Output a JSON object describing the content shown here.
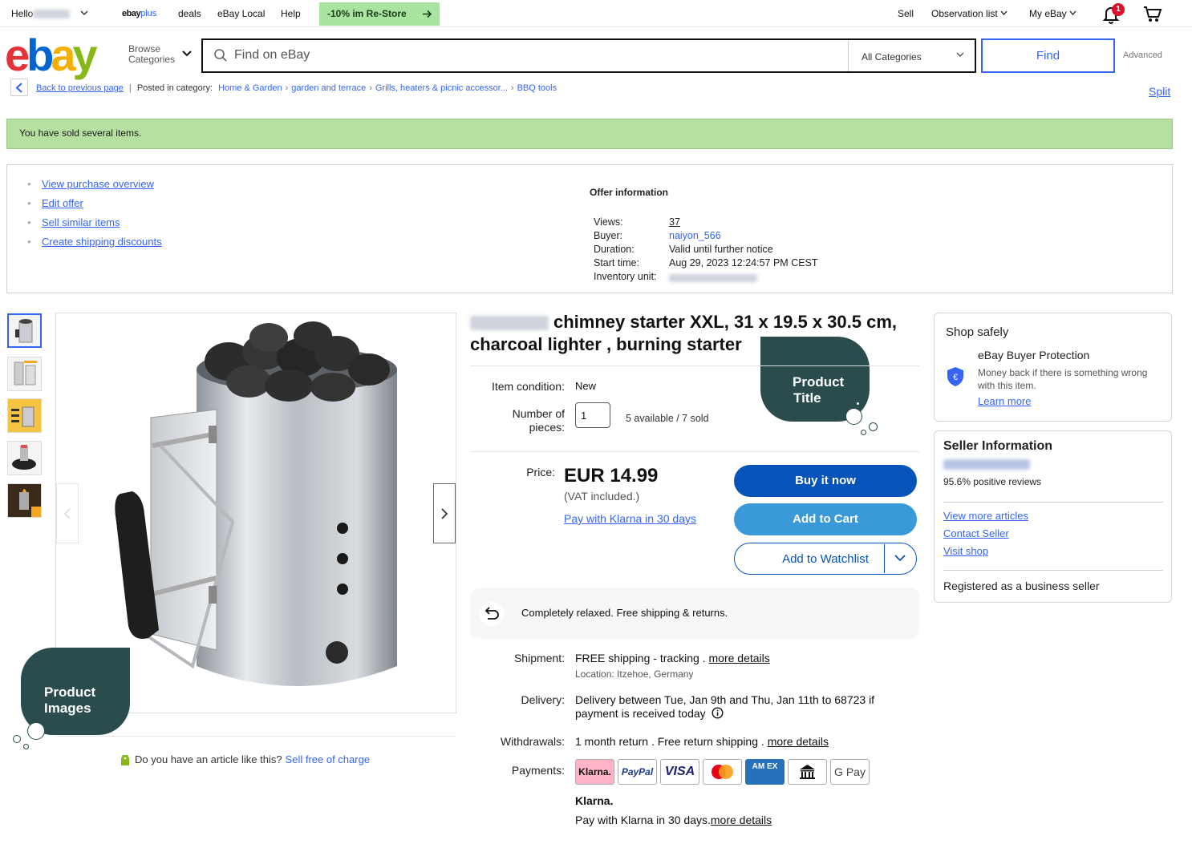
{
  "topbar": {
    "hello": "Hello",
    "ebay_plus_a": "ebay",
    "ebay_plus_b": "plus",
    "deals": "deals",
    "ebay_local": "eBay Local",
    "help": "Help",
    "restore": "-10% im Re-Store",
    "sell": "Sell",
    "observation": "Observation list",
    "my_ebay": "My eBay",
    "notification_count": "1"
  },
  "header": {
    "logo": [
      "e",
      "b",
      "a",
      "y"
    ],
    "browse_line1": "Browse",
    "browse_line2": "Categories",
    "search_placeholder": "Find on eBay",
    "category": "All Categories",
    "find": "Find",
    "advanced": "Advanced"
  },
  "breadcrumb": {
    "back": "Back to previous page",
    "posted_in": "Posted in category:",
    "items": [
      "Home & Garden",
      "garden and terrace",
      "Grills, heaters & picnic accessor...",
      "BBQ tools"
    ],
    "split": "Split"
  },
  "banner": {
    "sold_text": "You have sold several items."
  },
  "seller_actions": {
    "links": [
      "View purchase overview",
      "Edit offer",
      "Sell similar items",
      "Create shipping discounts"
    ]
  },
  "offer_info": {
    "title": "Offer information",
    "rows": [
      {
        "label": "Views:",
        "value": "37"
      },
      {
        "label": "Buyer:",
        "value": "naiyon_566"
      },
      {
        "label": "Duration:",
        "value": "Valid until further notice"
      },
      {
        "label": "Start time:",
        "value": "Aug 29, 2023 12:24:57 PM CEST"
      },
      {
        "label": "Inventory unit:",
        "value": ""
      }
    ]
  },
  "product": {
    "title": "chimney starter XXL, 31 x 19.5 x 30.5 cm, charcoal lighter , burning starter",
    "condition_label": "Item condition:",
    "condition_value": "New",
    "pieces_label_1": "Number of",
    "pieces_label_2": "pieces:",
    "quantity": "1",
    "availability": "5 available / 7 sold",
    "price_label": "Price:",
    "price": "EUR 14.99",
    "vat": "(VAT included.)",
    "klarna_link": "Pay with Klarna in 30 days",
    "buy_now": "Buy it now",
    "add_to_cart": "Add to Cart",
    "add_to_watchlist": "Add to Watchlist",
    "relaxed": "Completely relaxed. Free shipping & returns.",
    "shipment_label": "Shipment:",
    "shipment_value": "FREE shipping - tracking .",
    "more_details": "more details",
    "location": "Location: Itzehoe, Germany",
    "delivery_label": "Delivery:",
    "delivery_line1": "Delivery between Tue, Jan 9th and Thu, Jan 11th to 68723 if",
    "delivery_line2": "payment is received today",
    "withdrawals_label": "Withdrawals:",
    "withdrawals_value": "1 month return . Free return shipping .",
    "payments_label": "Payments:",
    "payment_methods": [
      "Klarna.",
      "PayPal",
      "VISA",
      "",
      "AM EX",
      "",
      "G Pay"
    ],
    "klarna_brand": "Klarna.",
    "klarna_footer": "Pay with Klarna in 30 days."
  },
  "media": {
    "sell_question": "Do you have an article like this?",
    "sell_free": "Sell free of charge"
  },
  "callouts": {
    "product_title_1": "Product",
    "product_title_2": "Title",
    "product_images_1": "Product",
    "product_images_2": "Images"
  },
  "shop_safely": {
    "title": "Shop safely",
    "protection": "eBay Buyer Protection",
    "money_back": "Money back if there is something wrong with this item.",
    "learn_more": "Learn more"
  },
  "seller_info": {
    "title": "Seller Information",
    "positive": "95.6% positive reviews",
    "links": [
      "View more articles",
      "Contact Seller",
      "Visit shop"
    ],
    "registered": "Registered as a business seller"
  },
  "colors": {
    "accent": "#3665f3",
    "buy_now": "#0654ba",
    "add_to_cart": "#3a9ad9",
    "banner": "#b6e0a2",
    "callout": "#2b4c4c"
  }
}
